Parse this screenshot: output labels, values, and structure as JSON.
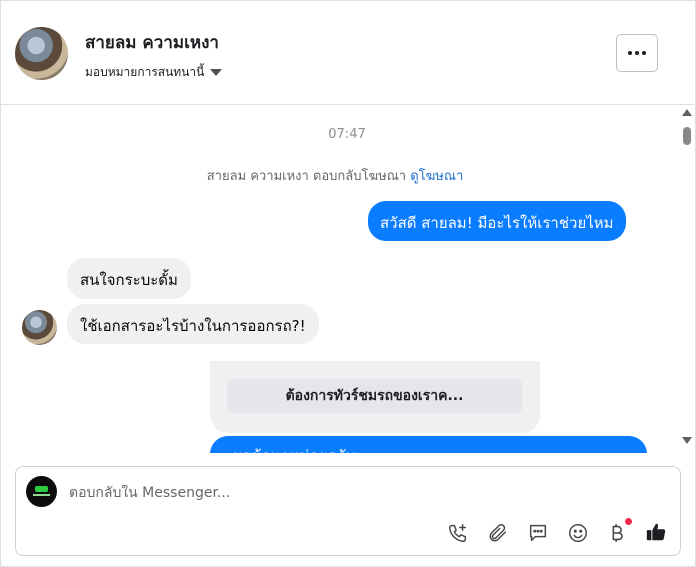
{
  "header": {
    "contact_name": "สายลม ความเหงา",
    "assign_label": "มอบหมายการสนทนานี้"
  },
  "chat": {
    "timestamp": "07:47",
    "ad_notice": "สายลม ความเหงา ตอบกลับโฆษณา",
    "ad_link": "ดูโฆษณา",
    "messages": [
      {
        "from": "page",
        "text": "สวัสดี สายลม! มีอะไรให้เราช่วยไหม"
      },
      {
        "from": "user",
        "text": "สนใจกระบะดั้ม"
      },
      {
        "from": "user",
        "text": "ใช้เอกสารอะไรบ้างในการออกรถ?!"
      }
    ],
    "card_button": "ต้องการทัวร์ชมรถของเราค...",
    "partial_message": "ขอข้อมูลหน่อยครับ"
  },
  "composer": {
    "placeholder": "ตอบกลับใน Messenger...",
    "icons": [
      "phone-plus-icon",
      "paperclip-icon",
      "saved-reply-icon",
      "emoji-icon",
      "baht-payment-icon",
      "like-icon"
    ],
    "colors": {
      "accent": "#0a7cff",
      "notification": "#f02849"
    }
  }
}
